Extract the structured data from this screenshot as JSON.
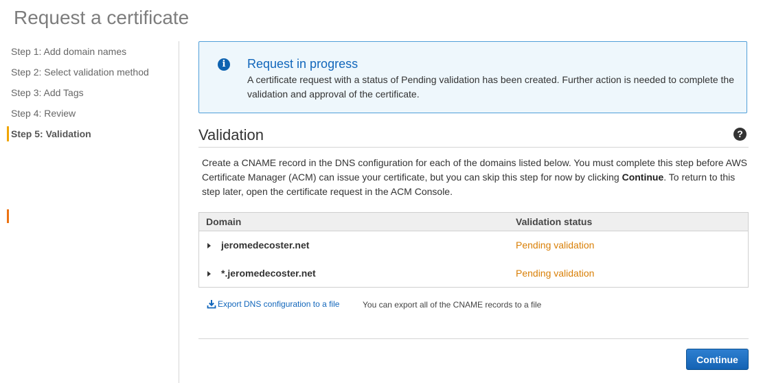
{
  "page": {
    "title": "Request a certificate"
  },
  "steps": [
    {
      "label": "Step 1: Add domain names"
    },
    {
      "label": "Step 2: Select validation method"
    },
    {
      "label": "Step 3: Add Tags"
    },
    {
      "label": "Step 4: Review"
    },
    {
      "label": "Step 5: Validation",
      "active": true
    }
  ],
  "alert": {
    "title": "Request in progress",
    "body": "A certificate request with a status of Pending validation has been created. Further action is needed to complete the validation and approval of the certificate.",
    "icon": "info-icon",
    "color": "#1166bb"
  },
  "validation": {
    "title": "Validation",
    "description_before": "Create a CNAME record in the DNS configuration for each of the domains listed below. You must complete this step before AWS Certificate Manager (ACM) can issue your certificate, but you can skip this step for now by clicking ",
    "description_bold": "Continue",
    "description_after": ". To return to this step later, open the certificate request in the ACM Console.",
    "table": {
      "columns": [
        "Domain",
        "Validation status"
      ],
      "rows": [
        {
          "domain": "jeromedecoster.net",
          "status": "Pending validation"
        },
        {
          "domain": "*.jeromedecoster.net",
          "status": "Pending validation"
        }
      ]
    },
    "status_color": "#d97f06"
  },
  "export": {
    "link_label": "Export DNS configuration to a file",
    "hint": "You can export all of the CNAME records to a file"
  },
  "footer": {
    "continue_label": "Continue"
  }
}
